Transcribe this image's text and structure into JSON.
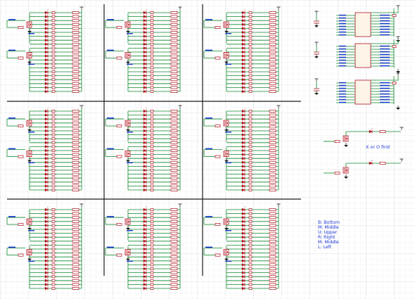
{
  "colors": {
    "background": "#ffffff",
    "grid": "#d9d9d9",
    "grid_major": "#c9c9c9",
    "wire": "#0f8a2d",
    "component": "#b3121f",
    "divider": "#1a1a1a",
    "label_blue": "#1d38d4",
    "ground": "#1a1a1a"
  },
  "icons": {
    "mosfet": "mosfet-symbol-icon",
    "resistor": "resistor-symbol-icon",
    "led": "led-symbol-icon",
    "ground": "ground-symbol-icon",
    "power": "power-flag-icon",
    "ic": "shift-register-ic-icon",
    "capacitor": "capacitor-symbol-icon"
  },
  "board": {
    "rows": 3,
    "cols": 3,
    "leds_per_cell": 21
  },
  "notes": {
    "first_player": "X or O first"
  },
  "legend": [
    "B: Bottom",
    "M: Middle",
    "U: Upper",
    "R: Right",
    "M: Middle",
    "L: Left"
  ]
}
